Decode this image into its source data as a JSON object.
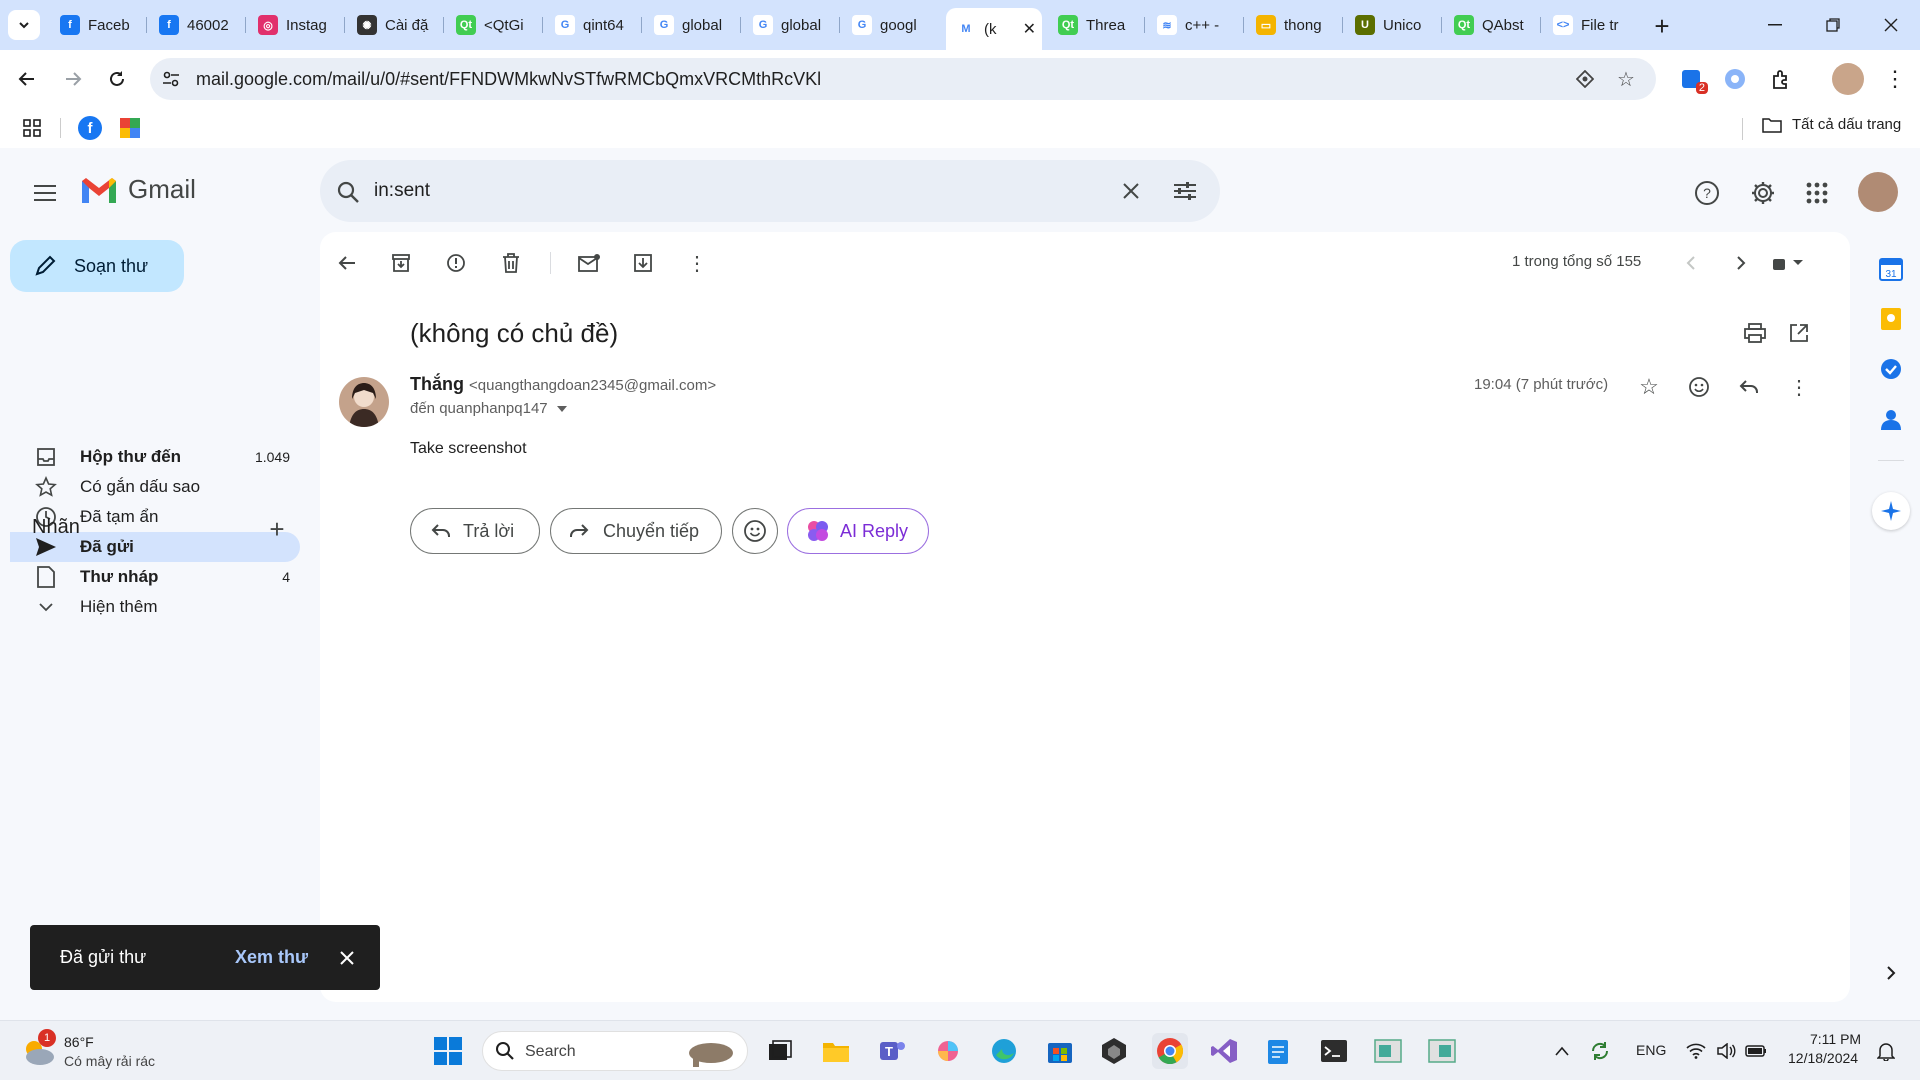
{
  "browser": {
    "tabs": [
      {
        "label": "Faceb",
        "icon": "facebook-icon",
        "color": "#1877f2",
        "glyph": "f"
      },
      {
        "label": "46002",
        "icon": "facebook-icon",
        "color": "#1877f2",
        "glyph": "f"
      },
      {
        "label": "Instag",
        "icon": "instagram-icon",
        "color": "#e1306c",
        "glyph": "◎"
      },
      {
        "label": "Cài đặ",
        "icon": "openai-icon",
        "color": "#333333",
        "glyph": "✺"
      },
      {
        "label": "<QtGi",
        "icon": "qt-icon",
        "color": "#41cd52",
        "glyph": "Qt"
      },
      {
        "label": "qint64",
        "icon": "google-icon",
        "color": "#ffffff",
        "glyph": "G"
      },
      {
        "label": "global",
        "icon": "google-icon",
        "color": "#ffffff",
        "glyph": "G"
      },
      {
        "label": "global",
        "icon": "google-icon",
        "color": "#ffffff",
        "glyph": "G"
      },
      {
        "label": "googl",
        "icon": "google-icon",
        "color": "#ffffff",
        "glyph": "G"
      },
      {
        "label": "(k",
        "icon": "gmail-icon",
        "color": "#ffffff",
        "glyph": "M",
        "active": true
      },
      {
        "label": "Threa",
        "icon": "qt-icon",
        "color": "#41cd52",
        "glyph": "Qt"
      },
      {
        "label": "c++ -",
        "icon": "stackoverflow-icon",
        "color": "#ffffff",
        "glyph": "≋"
      },
      {
        "label": "thong",
        "icon": "slides-icon",
        "color": "#f4b400",
        "glyph": "▭"
      },
      {
        "label": "Unico",
        "icon": "unicode-icon",
        "color": "#5b6e00",
        "glyph": "U"
      },
      {
        "label": "QAbst",
        "icon": "qt-icon",
        "color": "#41cd52",
        "glyph": "Qt"
      },
      {
        "label": "File tr",
        "icon": "code-icon",
        "color": "#ffffff",
        "glyph": "<>"
      }
    ],
    "url": "mail.google.com/mail/u/0/#sent/FFNDWMkwNvSTfwRMCbQmxVRCMthRcVKl",
    "extension_badge": "2",
    "bookmarks_label": "Tất cả dấu trang"
  },
  "gmail": {
    "logo_text": "Gmail",
    "search_query": "in:sent",
    "compose_label": "Soạn thư",
    "nav": [
      {
        "label": "Hộp thư đến",
        "count": "1.049",
        "icon": "inbox-icon",
        "bold": true
      },
      {
        "label": "Có gắn dấu sao",
        "count": "",
        "icon": "star-icon",
        "bold": false
      },
      {
        "label": "Đã tạm ẩn",
        "count": "",
        "icon": "clock-icon",
        "bold": false
      },
      {
        "label": "Đã gửi",
        "count": "",
        "icon": "send-icon",
        "bold": true,
        "active": true
      },
      {
        "label": "Thư nháp",
        "count": "4",
        "icon": "draft-icon",
        "bold": true
      },
      {
        "label": "Hiện thêm",
        "count": "",
        "icon": "chevron-down-icon",
        "bold": false
      }
    ],
    "labels_heading": "Nhãn",
    "pagination": "1 trong tổng số 155",
    "email": {
      "subject": "(không có chủ đề)",
      "sender_name": "Thắng",
      "sender_email": "<quangthangdoan2345@gmail.com>",
      "to_line": "đến quanphanpq147",
      "time": "19:04 (7 phút trước)",
      "body": "Take screenshot"
    },
    "actions": {
      "reply": "Trả lời",
      "forward": "Chuyển tiếp",
      "ai_reply": "AI Reply"
    },
    "snackbar": {
      "message": "Đã gửi thư",
      "action": "Xem thư"
    }
  },
  "taskbar": {
    "weather_temp": "86°F",
    "weather_desc": "Có mây rải rác",
    "weather_badge": "1",
    "search_placeholder": "Search",
    "language": "ENG",
    "time": "7:11 PM",
    "date": "12/18/2024"
  },
  "colors": {
    "accent": "#0b57d0",
    "compose_bg": "#c2e7ff",
    "active_nav": "#d3e3fd",
    "ai_purple": "#7b2cd6"
  }
}
